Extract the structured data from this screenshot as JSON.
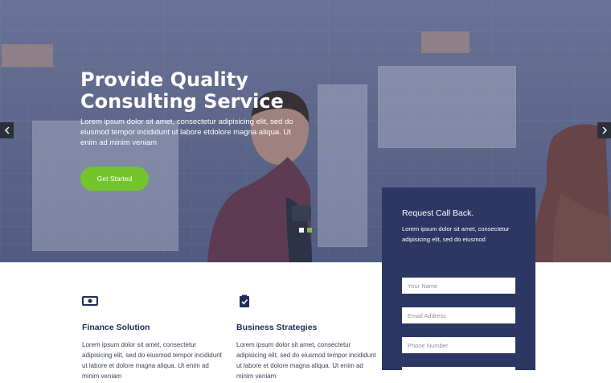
{
  "hero": {
    "title_line1": "Provide Quality",
    "title_line2": "Consulting Service",
    "description": "Lorem ipsum dolor sit amet, consectetur adipisicing elit, sed do eiusmod tempor incididunt ut labore etdolore magna aliqua. Ut enim ad minim veniam",
    "cta_label": "Get Started",
    "prev_icon": "chevron-left-icon",
    "next_icon": "chevron-right-icon",
    "slide_count": 2,
    "active_slide": 2
  },
  "features": [
    {
      "icon": "banknote-icon",
      "title": "Finance Solution",
      "text": "Lorem ipsum dolor sit amet, consectetur adipisicing elit, sed do eiusmod tempor incididunt ut labore et dolore magna aliqua. Ut enim ad minim veniam"
    },
    {
      "icon": "clipboard-check-icon",
      "title": "Business Strategies",
      "text": "Lorem ipsum dolor sit amet, consectetur adipisicing elit, sed do eiusmod tempor incididunt ut labore et dolore magna aliqua. Ut enim ad minim veniam"
    }
  ],
  "callback": {
    "title": "Request Call Back.",
    "description": "Lorem ipsum dolor sit amet, consectetur adipisicing elit, sed do eiusmod",
    "name_placeholder": "Your Name",
    "email_placeholder": "Email Address",
    "phone_placeholder": "Phone Number"
  },
  "colors": {
    "accent_green": "#72c52b",
    "panel_navy": "#2c3763",
    "heading_navy": "#1f2d5a"
  }
}
